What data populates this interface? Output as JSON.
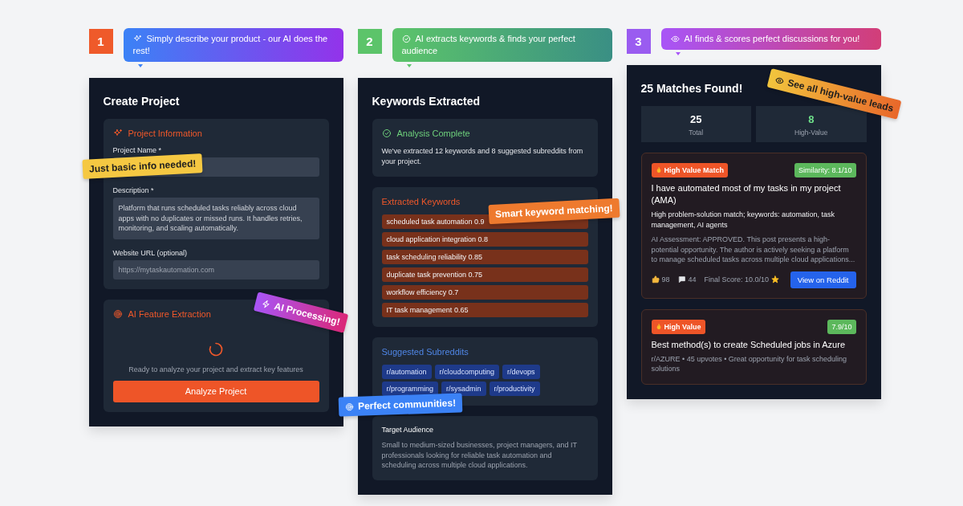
{
  "steps": [
    {
      "number": "1",
      "color": "#ef5a2a",
      "caption": "Simply describe your product - our AI does the rest!",
      "stickers": [
        {
          "text": "Just basic info needed!"
        },
        {
          "text": "AI Processing!"
        }
      ],
      "panel": {
        "kind": "create",
        "title": "Create Project",
        "info": {
          "heading": "Project Information",
          "fields": [
            {
              "label": "Project Name *",
              "kind": "input"
            },
            {
              "label": "Description *",
              "kind": "textarea",
              "value": "Platform that runs scheduled tasks reliably across cloud apps with no duplicates or missed runs. It handles retries, monitoring, and scaling automatically."
            },
            {
              "label": "Website URL (optional)",
              "kind": "input",
              "placeholder": "https://mytaskautomation.com"
            }
          ]
        },
        "extraction": {
          "heading": "AI Feature Extraction",
          "status": "Ready to analyze your project and extract key features",
          "button": "Analyze Project"
        }
      }
    },
    {
      "number": "2",
      "color": "#5cc46a",
      "caption": "AI extracts keywords & finds your perfect audience",
      "stickers": [
        {
          "text": "Smart keyword matching!"
        },
        {
          "text": "Perfect communities!"
        }
      ],
      "panel": {
        "kind": "keywords",
        "title": "Keywords Extracted",
        "analysis": {
          "heading": "Analysis Complete",
          "text": "We've extracted 12 keywords and 8 suggested subreddits from your project."
        },
        "keywords": {
          "heading": "Extracted Keywords",
          "items": [
            "scheduled task automation 0.9",
            "cloud application integration 0.8",
            "task scheduling reliability 0.85",
            "duplicate task prevention 0.75",
            "workflow efficiency 0.7",
            "IT task management 0.65"
          ]
        },
        "subreddits": {
          "heading": "Suggested Subreddits",
          "items": [
            "r/automation",
            "r/cloudcomputing",
            "r/devops",
            "r/programming",
            "r/sysadmin",
            "r/productivity"
          ]
        },
        "audience": {
          "heading": "Target Audience",
          "text": "Small to medium-sized businesses, project managers, and IT professionals looking for reliable task automation and scheduling across multiple cloud applications."
        }
      }
    },
    {
      "number": "3",
      "color": "#9a5cf0",
      "caption": "AI finds & scores perfect discussions for you!",
      "stickers": [
        {
          "text": "See all high-value leads"
        }
      ],
      "panel": {
        "kind": "matches",
        "title": "25 Matches Found!",
        "stats": [
          {
            "value": "25",
            "label": "Total",
            "color": "#ffffff"
          },
          {
            "value": "8",
            "label": "High-Value",
            "color": "#6ee08a"
          }
        ],
        "matches": [
          {
            "badge": "High Value Match",
            "score": "Similarity: 8.1/10",
            "title": "I have automated most of my tasks in my project (AMA)",
            "reason": "High problem-solution match; keywords: automation, task management, AI agents",
            "assessment": "AI Assessment: APPROVED. This post presents a high-potential opportunity. The author is actively seeking a platform to manage scheduled tasks across multiple cloud applications...",
            "likes": "98",
            "comments": "44",
            "final_score": "Final Score: 10.0/10",
            "button": "View on Reddit"
          },
          {
            "badge": "High Value",
            "score": "7.9/10",
            "title": "Best method(s) to create Scheduled jobs in Azure",
            "meta": "r/AZURE • 45 upvotes • Great opportunity for task scheduling solutions"
          }
        ]
      }
    }
  ]
}
